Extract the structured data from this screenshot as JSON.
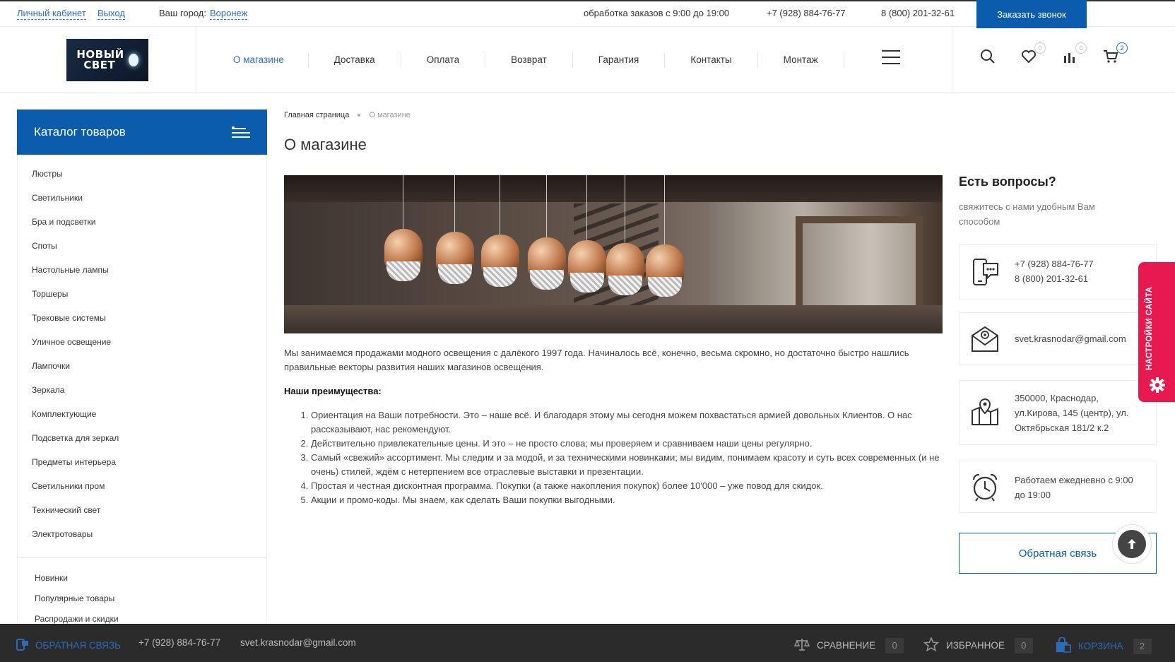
{
  "topbar": {
    "account_link": "Личный кабинет",
    "logout_link": "Выход",
    "city_label": "Ваш город:",
    "city_value": "Воронеж",
    "hours": "обработка заказов с 9:00 до 19:00",
    "phone1": "+7 (928) 884-76-77",
    "phone2": "8 (800) 201-32-61",
    "call_button": "Заказать звонок"
  },
  "header": {
    "logo_line1": "НОВЫЙ",
    "logo_line2": "СВЕТ",
    "nav": [
      {
        "label": "О магазине"
      },
      {
        "label": "Доставка"
      },
      {
        "label": "Оплата"
      },
      {
        "label": "Возврат"
      },
      {
        "label": "Гарантия"
      },
      {
        "label": "Контакты"
      },
      {
        "label": "Монтаж"
      }
    ],
    "favorites_count": "0",
    "compare_count": "0",
    "cart_count": "2"
  },
  "sidebar": {
    "catalog_title": "Каталог товаров",
    "categories": [
      "Люстры",
      "Светильники",
      "Бра и подсветки",
      "Споты",
      "Настольные лампы",
      "Торшеры",
      "Трековые системы",
      "Уличное освещение",
      "Лампочки",
      "Зеркала",
      "Комплектующие",
      "Подсветка для зеркал",
      "Предметы интерьера",
      "Светильники пром",
      "Технический свет",
      "Электротовары"
    ],
    "extras": [
      "Новинки",
      "Популярные товары",
      "Распродажи и скидки"
    ]
  },
  "main": {
    "breadcrumb_home": "Главная страница",
    "breadcrumb_current": "О магазине",
    "title": "О магазине",
    "intro": "Мы занимаемся продажами модного освещения с  далёкого 1997 года. Начиналось всё, конечно, весьма скромно, но достаточно быстро нашлись правильные векторы развития наших магазинов освещения.",
    "advantages_heading": "Наши преимущества:",
    "advantages": [
      "Ориентация на Ваши потребности. Это – наше всё. И благодаря этому мы сегодня можем похвастаться армией довольных Клиентов. О нас рассказывают, нас рекомендуют.",
      "Действительно привлекательные цены. И это – не просто слова; мы проверяем и сравниваем наши цены регулярно.",
      "Самый «свежий» ассортимент. Мы следим и за модой, и за техническими новинками; мы видим, понимаем красоту и суть всех современных (и не очень) стилей, ждём с нетерпением все отраслевые выставки и презентации.",
      "Простая и честная дисконтная программа. Покупки (а также накопления покупок) более 10'000 – уже повод для скидок.",
      "Акции и промо-коды. Мы знаем, как сделать Ваши покупки выгодными."
    ]
  },
  "contact": {
    "title": "Есть вопросы?",
    "subtitle": "свяжитесь с нами удобным Вам способом",
    "phone1": "+7 (928) 884-76-77",
    "phone2": "8 (800) 201-32-61",
    "email": "svet.krasnodar@gmail.com",
    "address_line1": "350000, Краснодар,",
    "address_line2": "ул.Кирова, 145 (центр), ул.",
    "address_line3": "Октябрьская 181/2 к.2",
    "hours_line1": "Работаем ежедневно с 9:00",
    "hours_line2": "до 19:00",
    "feedback_button": "Обратная связь"
  },
  "settings_tab": "НАСТРОЙКИ САЙТА",
  "bottombar": {
    "feedback": "ОБРАТНАЯ СВЯЗЬ",
    "phone": "+7 (928) 884-76-77",
    "email": "svet.krasnodar@gmail.com",
    "compare_label": "СРАВНЕНИЕ",
    "compare_count": "0",
    "favorites_label": "ИЗБРАННОЕ",
    "favorites_count": "0",
    "cart_label": "КОРЗИНА",
    "cart_count": "2"
  },
  "colors": {
    "accent": "#0b5cad",
    "link": "#2b6cb8",
    "settings": "#e8194f",
    "bottom_bar": "#2b2b2b"
  }
}
